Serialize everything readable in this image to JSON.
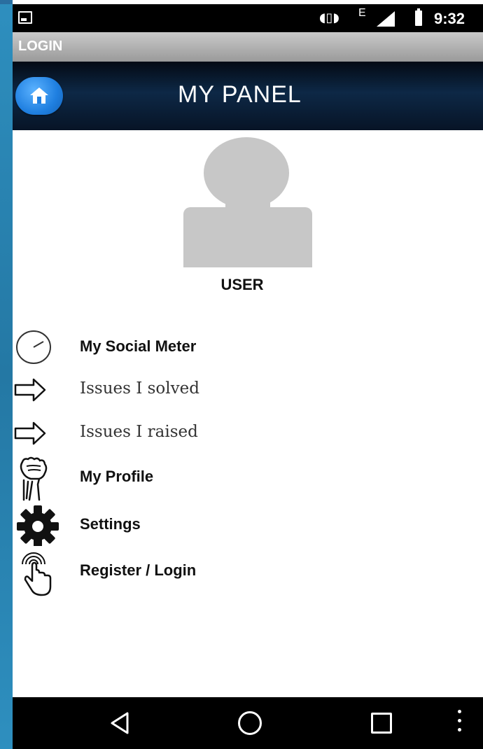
{
  "status_bar": {
    "time": "9:32",
    "network_type": "E",
    "icons": [
      "screenshot-icon",
      "vibrate-icon",
      "signal-icon",
      "battery-icon"
    ]
  },
  "title_bar": {
    "title": "LOGIN"
  },
  "header": {
    "title": "MY PANEL",
    "home_icon": "home-icon",
    "accent": "#1f7fe0"
  },
  "profile": {
    "name": "USER"
  },
  "menu": {
    "items": [
      {
        "label": "My Social Meter",
        "icon": "gauge-icon"
      },
      {
        "label": "Issues I solved",
        "icon": "arrow-right-icon"
      },
      {
        "label": "Issues I raised",
        "icon": "arrow-right-icon"
      },
      {
        "label": "My Profile",
        "icon": "fist-icon"
      },
      {
        "label": "Settings",
        "icon": "gear-icon"
      },
      {
        "label": "Register / Login",
        "icon": "touch-icon"
      }
    ]
  },
  "nav_bar": {
    "icons": [
      "back-icon",
      "home-circle-icon",
      "recents-icon",
      "overflow-menu-icon"
    ]
  }
}
